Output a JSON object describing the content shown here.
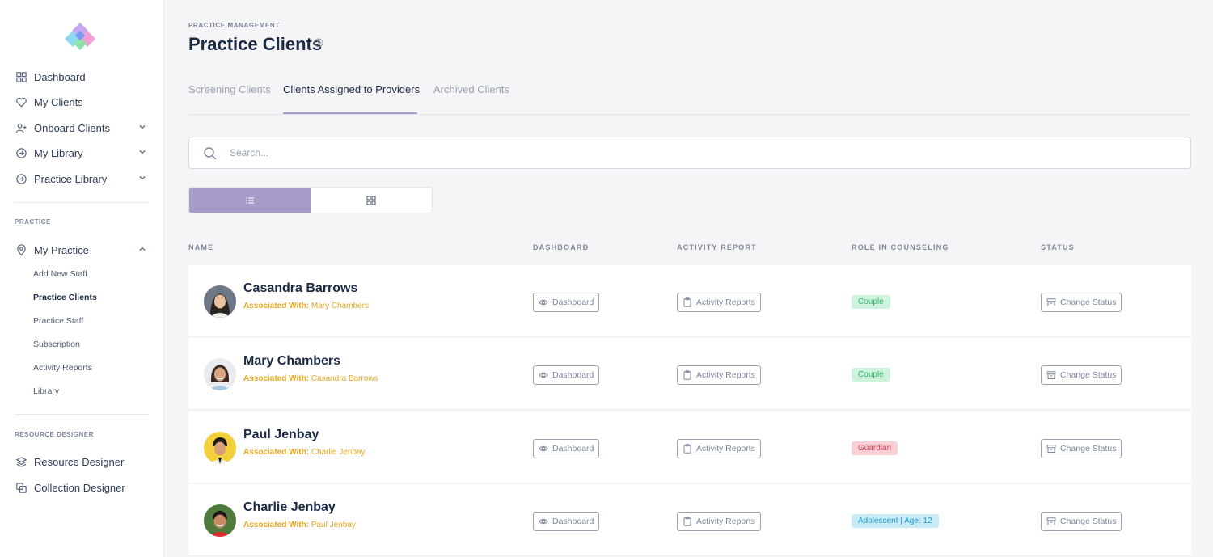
{
  "colors": {
    "accent": "#a89bc9",
    "associated_text": "#e9a824",
    "badge_couple_bg": "#cdf3dc",
    "badge_couple_text": "#2fb36a",
    "badge_guardian_bg": "#fad0d6",
    "badge_guardian_text": "#d9445b",
    "badge_adolescent_bg": "#c9ebf8",
    "badge_adolescent_text": "#1f9ac9"
  },
  "sidebar": {
    "nav": [
      {
        "label": "Dashboard",
        "icon": "grid-icon"
      },
      {
        "label": "My Clients",
        "icon": "heart-icon"
      },
      {
        "label": "Onboard Clients",
        "icon": "user-plus-icon",
        "expandable": true
      },
      {
        "label": "My Library",
        "icon": "arrow-circle-icon",
        "expandable": true
      },
      {
        "label": "Practice Library",
        "icon": "arrow-circle-icon",
        "expandable": true
      }
    ],
    "practice_section_title": "PRACTICE",
    "my_practice": {
      "label": "My Practice",
      "icon": "map-pin-icon",
      "expanded": true
    },
    "practice_items": [
      "Add New Staff",
      "Practice Clients",
      "Practice Staff",
      "Subscription",
      "Activity Reports",
      "Library"
    ],
    "active_practice_item": "Practice Clients",
    "resource_section_title": "RESOURCE DESIGNER",
    "resource_items": [
      {
        "label": "Resource Designer",
        "icon": "layers-icon"
      },
      {
        "label": "Collection Designer",
        "icon": "copy-icon"
      }
    ]
  },
  "header": {
    "breadcrumb": "PRACTICE MANAGEMENT",
    "title": "Practice Clients"
  },
  "tabs": [
    {
      "label": "Screening Clients",
      "active": false
    },
    {
      "label": "Clients Assigned to Providers",
      "active": true
    },
    {
      "label": "Archived Clients",
      "active": false
    }
  ],
  "search": {
    "placeholder": "Search..."
  },
  "view_toggle": {
    "selected": "list",
    "options": [
      "list-icon",
      "grid-icon"
    ]
  },
  "table": {
    "headers": [
      "NAME",
      "DASHBOARD",
      "ACTIVITY REPORT",
      "ROLE IN COUNSELING",
      "STATUS"
    ],
    "associated_prefix": "Associated With:",
    "dashboard_label": "Dashboard",
    "activity_label": "Activity Reports",
    "status_label": "Change Status",
    "rows": [
      {
        "name": "Casandra Barrows",
        "associated_with": "Mary Chambers",
        "role": "Couple",
        "role_type": "couple"
      },
      {
        "name": "Mary Chambers",
        "associated_with": "Casandra Barrows",
        "role": "Couple",
        "role_type": "couple"
      },
      {
        "name": "Paul Jenbay",
        "associated_with": "Charlie Jenbay",
        "role": "Guardian",
        "role_type": "guardian"
      },
      {
        "name": "Charlie Jenbay",
        "associated_with": "Paul Jenbay",
        "role": "Adolescent  | Age: 12",
        "role_type": "adolescent"
      }
    ]
  }
}
